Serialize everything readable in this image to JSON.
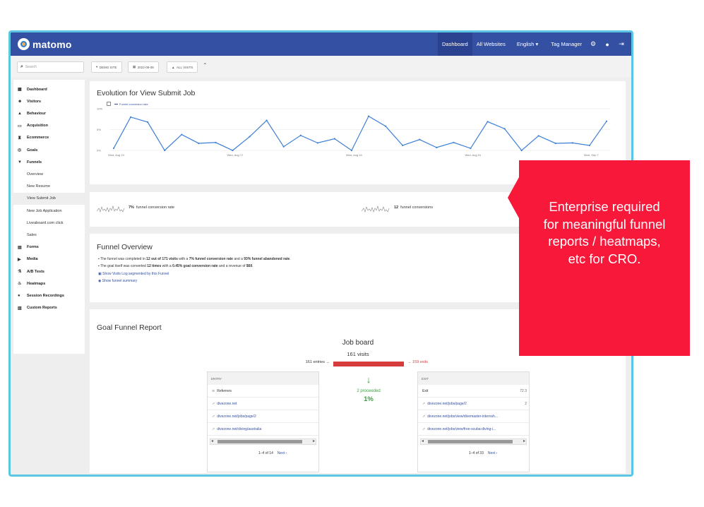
{
  "topbar": {
    "logo_text": "matomo",
    "nav": [
      "Dashboard",
      "All Websites",
      "English ▾",
      "Tag Manager"
    ],
    "active_nav": "Dashboard",
    "icons": [
      "gear-icon",
      "info-icon",
      "logout-icon"
    ],
    "color": "#3450a3"
  },
  "subbar": {
    "search_placeholder": "Search",
    "site_selector": "DEMO SITE",
    "date_selector": "2022-09-08",
    "segment_selector": "ALL VISITS"
  },
  "sidebar": {
    "items": [
      {
        "label": "Dashboard",
        "icon": "grid-icon",
        "type": "main"
      },
      {
        "label": "Visitors",
        "icon": "users-icon",
        "type": "main"
      },
      {
        "label": "Behaviour",
        "icon": "pointer-icon",
        "type": "main"
      },
      {
        "label": "Acquisition",
        "icon": "monitor-icon",
        "type": "main"
      },
      {
        "label": "Ecommerce",
        "icon": "cart-icon",
        "type": "main"
      },
      {
        "label": "Goals",
        "icon": "target-icon",
        "type": "main"
      },
      {
        "label": "Funnels",
        "icon": "funnel-icon",
        "type": "main"
      },
      {
        "label": "Overview",
        "type": "sub"
      },
      {
        "label": "New Resume",
        "type": "sub"
      },
      {
        "label": "View Submit Job",
        "type": "sub",
        "active": true
      },
      {
        "label": "New Job Application",
        "type": "sub"
      },
      {
        "label": "Liveaboard.com click",
        "type": "sub"
      },
      {
        "label": "Sales",
        "type": "sub"
      },
      {
        "label": "Forms",
        "icon": "form-icon",
        "type": "main"
      },
      {
        "label": "Media",
        "icon": "media-icon",
        "type": "main"
      },
      {
        "label": "A/B Tests",
        "icon": "flask-icon",
        "type": "main"
      },
      {
        "label": "Heatmaps",
        "icon": "flame-icon",
        "type": "main"
      },
      {
        "label": "Session Recordings",
        "icon": "record-icon",
        "type": "main"
      },
      {
        "label": "Custom Reports",
        "icon": "report-icon",
        "type": "main"
      }
    ]
  },
  "evolution": {
    "title": "Evolution for View Submit Job",
    "legend": "Funnel conversion rate"
  },
  "chart_data": {
    "type": "line",
    "series": [
      {
        "name": "Funnel conversion rate",
        "color": "#3d7fd6",
        "values": [
          0.5,
          8,
          6.8,
          0,
          3.8,
          1.7,
          1.9,
          0,
          3.3,
          7.2,
          0.9,
          3.6,
          1.8,
          2.8,
          0,
          8.2,
          5.8,
          1.2,
          2.6,
          0.7,
          1.9,
          0.5,
          6.9,
          5.2,
          0,
          3.5,
          1.7,
          1.8,
          1.2,
          7
        ]
      }
    ],
    "x_tick_labels": [
      "Wed, Aug 10",
      "Wed, Aug 17",
      "Wed, Aug 24",
      "Wed, Aug 31",
      "Wed, Sep 7"
    ],
    "y_tick_labels": [
      "10%",
      "5%",
      "0%"
    ],
    "ylim": [
      0,
      10
    ],
    "grid": true
  },
  "sparklines": {
    "rate_value": "7%",
    "rate_label": "funnel conversion rate",
    "conv_value": "12",
    "conv_label": "funnel conversions"
  },
  "overview": {
    "title": "Funnel Overview",
    "line1": {
      "p1": "The funnel was completed in ",
      "b1": "12 out of 171 visits",
      "p2": " with a ",
      "b2": "7% funnel conversion rate",
      "p3": " and a ",
      "b3": "93% funnel abandoned rate",
      "p4": "."
    },
    "line2": {
      "p1": "The goal itself was converted ",
      "b1": "12 times",
      "p2": " with a ",
      "b2": "0.45% goal conversion rate",
      "p3": " and a revenue of ",
      "b3": "$60",
      "p4": "."
    },
    "link1": "Show Visits Log segmented by this Funnel",
    "link2": "Show funnel summary"
  },
  "goal_report": {
    "title": "Goal Funnel Report",
    "step_title": "Job board",
    "step_visits": "161 visits",
    "entries": "161 entries",
    "exits": "159 exits",
    "proceeded": "2 proceeded",
    "proceeded_pct": "1%",
    "entry": {
      "header": "ENTRY",
      "rows": [
        "Referrers",
        "divezone.net",
        "divezone.net/jobs/page/2",
        "divezone.net/diving/australia"
      ],
      "pager": "1–4 of 14",
      "next": "Next ›"
    },
    "exit": {
      "header": "EXIT",
      "rows": [
        "Exit",
        "divezone.net/jobs/page/2",
        "divezone.net/jobs/view/divemaster-internsh...",
        "divezone.net/jobs/view/free-scuba-diving-i..."
      ],
      "first_row_value": "72.3",
      "second_row_value": "2",
      "pager": "1–4 of 33",
      "next": "Next ›"
    }
  },
  "callout": {
    "text": "Enterprise required for meaningful funnel reports / heatmaps, etc for CRO.",
    "color": "#f8183a"
  }
}
